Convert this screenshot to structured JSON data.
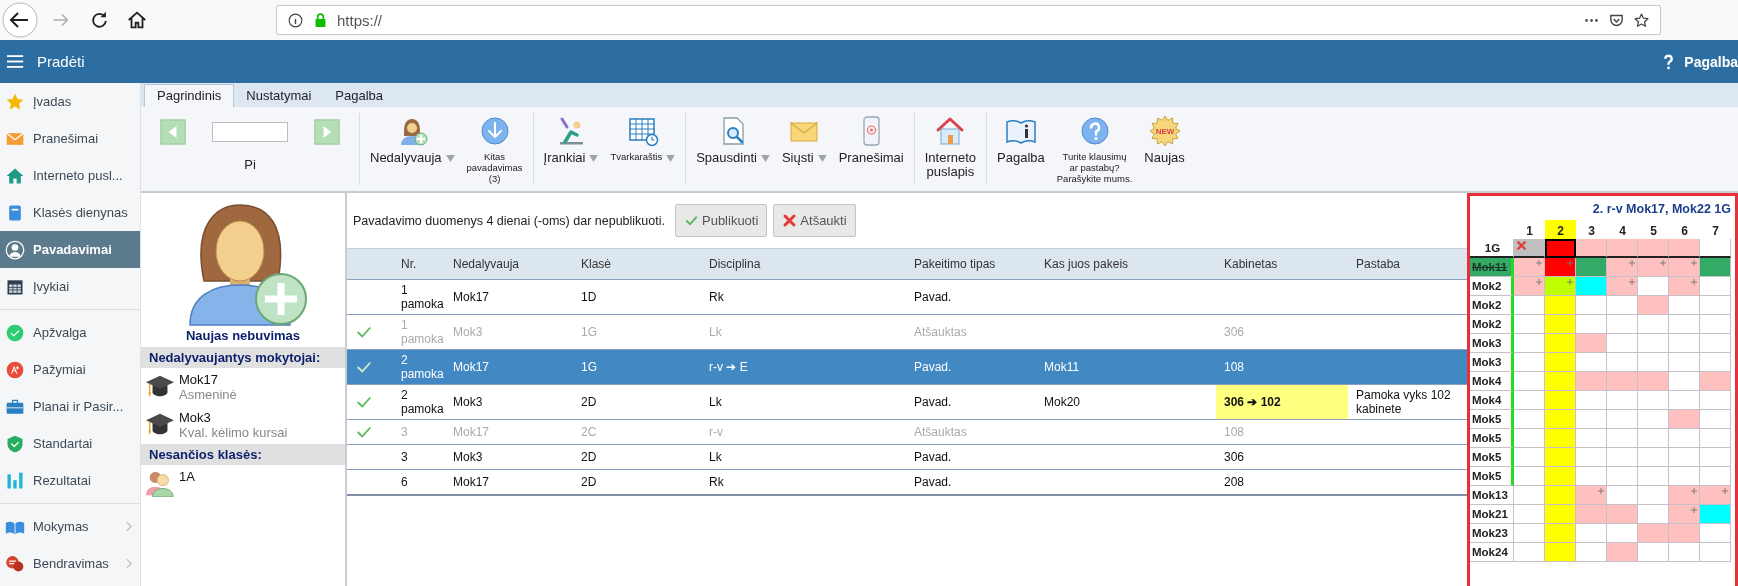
{
  "browser": {
    "url": "https://",
    "forward_disabled": true
  },
  "header": {
    "title": "Pradėti",
    "help": "Pagalba"
  },
  "sidebar": {
    "groups": [
      {
        "items": [
          {
            "label": "Įvadas",
            "selected": false,
            "submenu": false
          },
          {
            "label": "Pranešimai",
            "selected": false,
            "submenu": false
          },
          {
            "label": "Interneto pusl...",
            "selected": false,
            "submenu": false
          },
          {
            "label": "Klasės dienynas",
            "selected": false,
            "submenu": false
          },
          {
            "label": "Pavadavimai",
            "selected": true,
            "submenu": false
          },
          {
            "label": "Įvykiai",
            "selected": false,
            "submenu": false
          }
        ]
      },
      {
        "items": [
          {
            "label": "Apžvalga",
            "selected": false,
            "submenu": false
          },
          {
            "label": "Pažymiai",
            "selected": false,
            "submenu": false
          },
          {
            "label": "Planai ir Pasir...",
            "selected": false,
            "submenu": false
          },
          {
            "label": "Standartai",
            "selected": false,
            "submenu": false
          },
          {
            "label": "Rezultatai",
            "selected": false,
            "submenu": false
          }
        ]
      },
      {
        "items": [
          {
            "label": "Mokymas",
            "selected": false,
            "submenu": true
          },
          {
            "label": "Bendravimas",
            "selected": false,
            "submenu": true
          }
        ]
      }
    ]
  },
  "ribbon": {
    "tabs": [
      {
        "label": "Pagrindinis",
        "selected": true
      },
      {
        "label": "Nustatymai",
        "selected": false
      },
      {
        "label": "Pagalba",
        "selected": false
      }
    ],
    "groups": [
      {
        "items": [
          {
            "kind": "pager",
            "label": "Pi"
          }
        ]
      },
      {
        "items": [
          {
            "kind": "button",
            "label": "Nedalyvauja",
            "dropdown": true,
            "small": false
          },
          {
            "kind": "button",
            "label": "Kitas\npavadavimas\n(3)",
            "dropdown": false,
            "small": true
          }
        ]
      },
      {
        "items": [
          {
            "kind": "button",
            "label": "Įrankiai",
            "dropdown": true,
            "small": false
          },
          {
            "kind": "button",
            "label": "Tvarkaraštis",
            "dropdown": true,
            "small": true
          }
        ]
      },
      {
        "items": [
          {
            "kind": "button",
            "label": "Spausdinti",
            "dropdown": true,
            "small": false
          },
          {
            "kind": "button",
            "label": "Siųsti",
            "dropdown": true,
            "small": false
          },
          {
            "kind": "button",
            "label": "Pranešimai",
            "dropdown": false,
            "small": false
          }
        ]
      },
      {
        "items": [
          {
            "kind": "button",
            "label": "Interneto\npuslapis",
            "dropdown": false,
            "small": false
          }
        ]
      },
      {
        "items": [
          {
            "kind": "button",
            "label": "Pagalba",
            "dropdown": false,
            "small": false
          },
          {
            "kind": "button",
            "label": "Turite klausimų\nar pastabų?\nParašykite mums.",
            "dropdown": false,
            "small": true
          },
          {
            "kind": "button",
            "label": "Naujas",
            "badge": "NEW",
            "dropdown": false,
            "small": false
          }
        ]
      }
    ]
  },
  "absence": {
    "title": "Naujas nebuvimas",
    "teachers_heading": "Nedalyvaujantys mokytojai:",
    "teachers": [
      {
        "name": "Mok17",
        "reason": "Asmeninė"
      },
      {
        "name": "Mok3",
        "reason": "Kval. kėlimo kursai"
      }
    ],
    "classes_heading": "Nesančios klasės:",
    "classes": [
      "1A"
    ]
  },
  "substitutions": {
    "notice": "Pavadavimo duomenys 4 dienai (-oms) dar nepublikuoti.",
    "buttons": [
      {
        "label": "Publikuoti"
      },
      {
        "label": "Atšaukti"
      }
    ],
    "columns": [
      "Nr.",
      "Nedalyvauja",
      "Klasė",
      "Disciplina",
      "Pakeitimo tipas",
      "Kas juos pakeis",
      "Kabinetas",
      "Pastaba"
    ],
    "rows": [
      {
        "checked": false,
        "cancelled": false,
        "selected": false,
        "nr": "1 pamoka",
        "absent": "Mok17",
        "class": "1D",
        "subject": "Rk",
        "change_type": "Pavad.",
        "substitute": "",
        "room": "",
        "room_changed": false,
        "note": ""
      },
      {
        "checked": true,
        "cancelled": true,
        "selected": false,
        "nr": "1 pamoka",
        "absent": "Mok3",
        "class": "1G",
        "subject": "Lk",
        "change_type": "Atšauktas",
        "substitute": "",
        "room": "306",
        "room_changed": false,
        "note": ""
      },
      {
        "checked": true,
        "cancelled": false,
        "selected": true,
        "nr": "2 pamoka",
        "absent": "Mok17",
        "class": "1G",
        "subject": "r-v ➔ E",
        "change_type": "Pavad.",
        "substitute": "Mok11",
        "room": "108",
        "room_changed": false,
        "note": ""
      },
      {
        "checked": true,
        "cancelled": false,
        "selected": false,
        "nr": "2 pamoka",
        "absent": "Mok3",
        "class": "2D",
        "subject": "Lk",
        "change_type": "Pavad.",
        "substitute": "Mok20",
        "room": "306 ➔ 102",
        "room_changed": true,
        "note": "Pamoka vyks 102 kabinete"
      },
      {
        "checked": true,
        "cancelled": true,
        "selected": false,
        "nr": "3",
        "absent": "Mok17",
        "class": "2C",
        "subject": "r-v",
        "change_type": "Atšauktas",
        "substitute": "",
        "room": "108",
        "room_changed": false,
        "note": ""
      },
      {
        "checked": false,
        "cancelled": false,
        "selected": false,
        "nr": "3",
        "absent": "Mok3",
        "class": "2D",
        "subject": "Lk",
        "change_type": "Pavad.",
        "substitute": "",
        "room": "306",
        "room_changed": false,
        "note": ""
      },
      {
        "checked": false,
        "cancelled": false,
        "selected": false,
        "nr": "6",
        "absent": "Mok17",
        "class": "2D",
        "subject": "Rk",
        "change_type": "Pavad.",
        "substitute": "",
        "room": "208",
        "room_changed": false,
        "note": ""
      }
    ]
  },
  "schedule": {
    "title": "2. r-v Mok17, Mok22 1G",
    "periods": [
      {
        "label": "1",
        "selected": false
      },
      {
        "label": "2",
        "selected": true
      },
      {
        "label": "3",
        "selected": false
      },
      {
        "label": "4",
        "selected": false
      },
      {
        "label": "5",
        "selected": false
      },
      {
        "label": "6",
        "selected": false
      },
      {
        "label": "7",
        "selected": false
      }
    ],
    "class_row": {
      "label": "1G",
      "cells": [
        {
          "color": "#c0c0c0",
          "cancelled": true,
          "selected": false
        },
        {
          "color": "#ff0000",
          "cancelled": false,
          "selected": true
        },
        {
          "color": "#ffc0c0",
          "cancelled": false,
          "selected": false
        },
        {
          "color": "#ffc0c0",
          "cancelled": false,
          "selected": false
        },
        {
          "color": "#ffc0c0",
          "cancelled": false,
          "selected": false
        },
        {
          "color": "#ffc0c0",
          "cancelled": false,
          "selected": false
        },
        {
          "color": "#ffffff",
          "cancelled": false,
          "selected": false
        }
      ]
    },
    "teachers": [
      {
        "name": "Mok11",
        "struck": true,
        "available": true,
        "cells": [
          {
            "color": "#ffc0c0",
            "plus": true
          },
          {
            "color": "#ff0000",
            "plus": true
          },
          {
            "color": "#33aa66",
            "plus": false
          },
          {
            "color": "#ffc0c0",
            "plus": true
          },
          {
            "color": "#ffc0c0",
            "plus": true
          },
          {
            "color": "#ffc0c0",
            "plus": true
          },
          {
            "color": "#33aa66",
            "plus": false
          }
        ]
      },
      {
        "name": "Mok2",
        "struck": false,
        "available": true,
        "cells": [
          {
            "color": "#ffc0c0",
            "plus": true
          },
          {
            "color": "#bfff00",
            "plus": true
          },
          {
            "color": "#00ffff",
            "plus": false
          },
          {
            "color": "#ffc0c0",
            "plus": true
          },
          {
            "color": "#ffffff",
            "plus": false
          },
          {
            "color": "#ffc0c0",
            "plus": true
          },
          {
            "color": "#ffffff",
            "plus": false
          }
        ]
      },
      {
        "name": "Mok2",
        "struck": false,
        "available": true,
        "cells": [
          {
            "color": "#ffffff",
            "plus": false
          },
          {
            "color": "#ffff00",
            "plus": false
          },
          {
            "color": "#ffffff",
            "plus": false
          },
          {
            "color": "#ffffff",
            "plus": false
          },
          {
            "color": "#ffc0c0",
            "plus": false
          },
          {
            "color": "#ffffff",
            "plus": false
          },
          {
            "color": "#ffffff",
            "plus": false
          }
        ]
      },
      {
        "name": "Mok2",
        "struck": false,
        "available": true,
        "cells": [
          {
            "color": "#ffffff",
            "plus": false
          },
          {
            "color": "#ffff00",
            "plus": false
          },
          {
            "color": "#ffffff",
            "plus": false
          },
          {
            "color": "#ffffff",
            "plus": false
          },
          {
            "color": "#ffffff",
            "plus": false
          },
          {
            "color": "#ffffff",
            "plus": false
          },
          {
            "color": "#ffffff",
            "plus": false
          }
        ]
      },
      {
        "name": "Mok3",
        "struck": false,
        "available": true,
        "cells": [
          {
            "color": "#ffffff",
            "plus": false
          },
          {
            "color": "#ffff00",
            "plus": false
          },
          {
            "color": "#ffc0c0",
            "plus": false
          },
          {
            "color": "#ffffff",
            "plus": false
          },
          {
            "color": "#ffffff",
            "plus": false
          },
          {
            "color": "#ffffff",
            "plus": false
          },
          {
            "color": "#ffffff",
            "plus": false
          }
        ]
      },
      {
        "name": "Mok3",
        "struck": false,
        "available": true,
        "cells": [
          {
            "color": "#ffffff",
            "plus": false
          },
          {
            "color": "#ffff00",
            "plus": false
          },
          {
            "color": "#ffffff",
            "plus": false
          },
          {
            "color": "#ffffff",
            "plus": false
          },
          {
            "color": "#ffffff",
            "plus": false
          },
          {
            "color": "#ffffff",
            "plus": false
          },
          {
            "color": "#ffffff",
            "plus": false
          }
        ]
      },
      {
        "name": "Mok4",
        "struck": false,
        "available": true,
        "cells": [
          {
            "color": "#ffffff",
            "plus": false
          },
          {
            "color": "#ffff00",
            "plus": false
          },
          {
            "color": "#ffc0c0",
            "plus": false
          },
          {
            "color": "#ffc0c0",
            "plus": false
          },
          {
            "color": "#ffc0c0",
            "plus": false
          },
          {
            "color": "#ffffff",
            "plus": false
          },
          {
            "color": "#ffc0c0",
            "plus": false
          }
        ]
      },
      {
        "name": "Mok4",
        "struck": false,
        "available": true,
        "cells": [
          {
            "color": "#ffffff",
            "plus": false
          },
          {
            "color": "#ffff00",
            "plus": false
          },
          {
            "color": "#ffffff",
            "plus": false
          },
          {
            "color": "#ffffff",
            "plus": false
          },
          {
            "color": "#ffffff",
            "plus": false
          },
          {
            "color": "#ffffff",
            "plus": false
          },
          {
            "color": "#ffffff",
            "plus": false
          }
        ]
      },
      {
        "name": "Mok5",
        "struck": false,
        "available": true,
        "cells": [
          {
            "color": "#ffffff",
            "plus": false
          },
          {
            "color": "#ffff00",
            "plus": false
          },
          {
            "color": "#ffffff",
            "plus": false
          },
          {
            "color": "#ffffff",
            "plus": false
          },
          {
            "color": "#ffffff",
            "plus": false
          },
          {
            "color": "#ffc0c0",
            "plus": false
          },
          {
            "color": "#ffffff",
            "plus": false
          }
        ]
      },
      {
        "name": "Mok5",
        "struck": false,
        "available": true,
        "cells": [
          {
            "color": "#ffffff",
            "plus": false
          },
          {
            "color": "#ffff00",
            "plus": false
          },
          {
            "color": "#ffffff",
            "plus": false
          },
          {
            "color": "#ffffff",
            "plus": false
          },
          {
            "color": "#ffffff",
            "plus": false
          },
          {
            "color": "#ffffff",
            "plus": false
          },
          {
            "color": "#ffffff",
            "plus": false
          }
        ]
      },
      {
        "name": "Mok5",
        "struck": false,
        "available": true,
        "cells": [
          {
            "color": "#ffffff",
            "plus": false
          },
          {
            "color": "#ffff00",
            "plus": false
          },
          {
            "color": "#ffffff",
            "plus": false
          },
          {
            "color": "#ffffff",
            "plus": false
          },
          {
            "color": "#ffffff",
            "plus": false
          },
          {
            "color": "#ffffff",
            "plus": false
          },
          {
            "color": "#ffffff",
            "plus": false
          }
        ]
      },
      {
        "name": "Mok5",
        "struck": false,
        "available": true,
        "cells": [
          {
            "color": "#ffffff",
            "plus": false
          },
          {
            "color": "#ffff00",
            "plus": false
          },
          {
            "color": "#ffffff",
            "plus": false
          },
          {
            "color": "#ffffff",
            "plus": false
          },
          {
            "color": "#ffffff",
            "plus": false
          },
          {
            "color": "#ffffff",
            "plus": false
          },
          {
            "color": "#ffffff",
            "plus": false
          }
        ]
      },
      {
        "name": "Mok13",
        "struck": false,
        "available": false,
        "cells": [
          {
            "color": "#ffffff",
            "plus": false
          },
          {
            "color": "#ffff00",
            "plus": false
          },
          {
            "color": "#ffc0c0",
            "plus": true
          },
          {
            "color": "#ffffff",
            "plus": false
          },
          {
            "color": "#ffffff",
            "plus": false
          },
          {
            "color": "#ffc0c0",
            "plus": true
          },
          {
            "color": "#ffc0c0",
            "plus": true
          }
        ]
      },
      {
        "name": "Mok21",
        "struck": false,
        "available": false,
        "cells": [
          {
            "color": "#ffffff",
            "plus": false
          },
          {
            "color": "#ffff00",
            "plus": false
          },
          {
            "color": "#ffc0c0",
            "plus": false
          },
          {
            "color": "#ffc0c0",
            "plus": false
          },
          {
            "color": "#ffffff",
            "plus": false
          },
          {
            "color": "#ffc0c0",
            "plus": true
          },
          {
            "color": "#00ffff",
            "plus": false
          }
        ]
      },
      {
        "name": "Mok23",
        "struck": false,
        "available": false,
        "cells": [
          {
            "color": "#ffffff",
            "plus": false
          },
          {
            "color": "#ffff00",
            "plus": false
          },
          {
            "color": "#ffffff",
            "plus": false
          },
          {
            "color": "#ffffff",
            "plus": false
          },
          {
            "color": "#ffc0c0",
            "plus": false
          },
          {
            "color": "#ffc0c0",
            "plus": false
          },
          {
            "color": "#ffffff",
            "plus": false
          }
        ]
      },
      {
        "name": "Mok24",
        "struck": false,
        "available": false,
        "cells": [
          {
            "color": "#ffffff",
            "plus": false
          },
          {
            "color": "#ffff00",
            "plus": false
          },
          {
            "color": "#ffffff",
            "plus": false
          },
          {
            "color": "#ffc0c0",
            "plus": false
          },
          {
            "color": "#ffffff",
            "plus": false
          },
          {
            "color": "#ffffff",
            "plus": false
          },
          {
            "color": "#ffffff",
            "plus": false
          }
        ]
      }
    ]
  }
}
